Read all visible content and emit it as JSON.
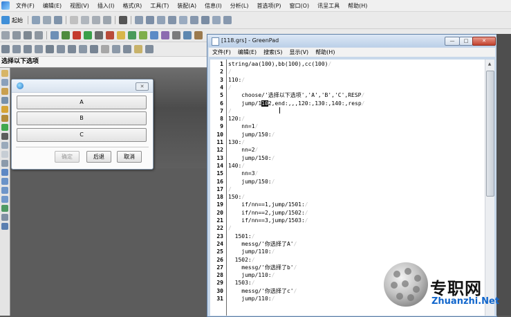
{
  "cad": {
    "menu": [
      "文件(F)",
      "编辑(E)",
      "视图(V)",
      "插入(I)",
      "格式(R)",
      "工具(T)",
      "装配(A)",
      "信息(I)",
      "分析(L)",
      "首选项(P)",
      "窗口(O)",
      "讯呈工具",
      "帮助(H)"
    ],
    "toolbar_start_label": "起始",
    "prompt": "选择以下选项"
  },
  "dialog": {
    "options": [
      "A",
      "B",
      "C"
    ],
    "buttons": {
      "ok": "确定",
      "back": "后退",
      "cancel": "取消"
    },
    "close_glyph": "✕"
  },
  "greenpad": {
    "title": "[118.grs] - GreenPad",
    "window_buttons": {
      "min": "—",
      "max": "□",
      "close": "✕"
    },
    "menu": [
      "文件(F)",
      "编辑(E)",
      "搜索(S)",
      "显示(V)",
      "帮助(H)"
    ],
    "lines": [
      {
        "n": "1",
        "t": "string/aa(100),bb(100),cc(100)"
      },
      {
        "n": "2",
        "t": ""
      },
      {
        "n": "3",
        "t": "110:"
      },
      {
        "n": "4",
        "t": ""
      },
      {
        "n": "5",
        "t": "    choose/'选择以下选项','A','B','C',RESP"
      },
      {
        "n": "6",
        "t": "    jump/1",
        "cur": "10",
        "t2": "2,end:,,,120:,130:,140:,resp"
      },
      {
        "n": "7",
        "t": ""
      },
      {
        "n": "8",
        "t": "120:"
      },
      {
        "n": "9",
        "t": "    nn=1"
      },
      {
        "n": "10",
        "t": "    jump/150:"
      },
      {
        "n": "11",
        "t": "130:"
      },
      {
        "n": "12",
        "t": "    nn=2"
      },
      {
        "n": "13",
        "t": "    jump/150:"
      },
      {
        "n": "14",
        "t": "140:"
      },
      {
        "n": "15",
        "t": "    nn=3"
      },
      {
        "n": "16",
        "t": "    jump/150:"
      },
      {
        "n": "17",
        "t": ""
      },
      {
        "n": "18",
        "t": "150:"
      },
      {
        "n": "19",
        "t": "    if/nn==1,jump/1501:"
      },
      {
        "n": "20",
        "t": "    if/nn==2,jump/1502:"
      },
      {
        "n": "21",
        "t": "    if/nn==3,jump/1503:"
      },
      {
        "n": "22",
        "t": ""
      },
      {
        "n": "23",
        "t": "  1501:"
      },
      {
        "n": "24",
        "t": "    messg/'你选择了A'"
      },
      {
        "n": "25",
        "t": "    jump/110:"
      },
      {
        "n": "26",
        "t": "  1502:"
      },
      {
        "n": "27",
        "t": "    messg/'你选择了b'"
      },
      {
        "n": "28",
        "t": "    jump/110:"
      },
      {
        "n": "29",
        "t": "  1503:"
      },
      {
        "n": "30",
        "t": "    messg/'你选择了c'"
      },
      {
        "n": "31",
        "t": "    jump/110:"
      }
    ]
  },
  "watermark": {
    "cn": "专职网",
    "en": "Zhuanzhi.Net"
  },
  "colors": {
    "accent": "#1166cc",
    "eol_marker": "#c3c3c3",
    "canvas": "#5c5c5c"
  }
}
